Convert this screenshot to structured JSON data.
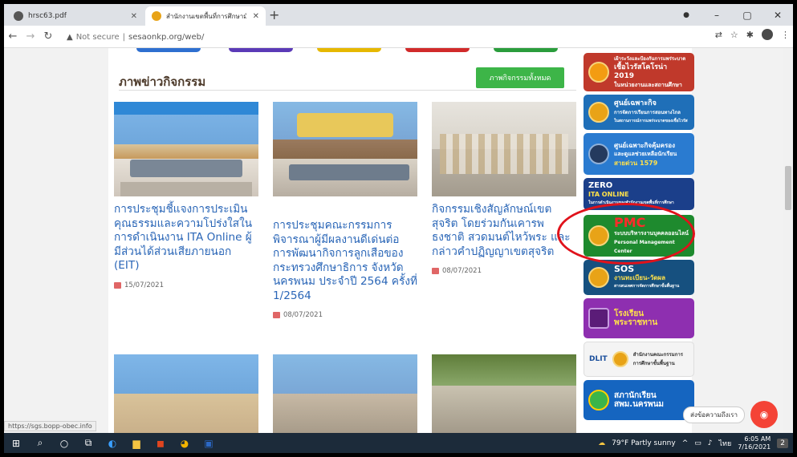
{
  "tabs": [
    {
      "title": "hrsc63.pdf"
    },
    {
      "title": "สำนักงานเขตพื้นที่การศึกษามัธยมศึกษ"
    }
  ],
  "address": {
    "security": "Not secure",
    "separator": "|",
    "url": "sesaonkp.org/web/"
  },
  "section": {
    "title": "ภาพข่าวกิจกรรม",
    "all_button": "ภาพกิจกรรมทั้งหมด"
  },
  "cards": [
    {
      "title": "การประชุมชี้แจงการประเมินคุณธรรมและความโปร่งใสในการดำเนินงาน ITA Online ผู้มีส่วนได้ส่วนเสียภายนอก (EIT)",
      "date": "15/07/2021"
    },
    {
      "title": "การประชุมคณะกรรมการพิจารณาผู้มีผลงานดีเด่นต่อการพัฒนากิจการลูกเสือของกระทรวงศึกษาธิการ จังหวัดนครพนม ประจำปี 2564 ครั้งที่ 1/2564",
      "date": "08/07/2021"
    },
    {
      "title": "กิจกรรมเชิงสัญลักษณ์เขตสุจริต โดยร่วมกันเคารพธงชาติ สวดมนต์ไหว้พระ และกล่าวคำปฏิญญาเขตสุจริต",
      "date": "08/07/2021"
    }
  ],
  "banners": [
    {
      "line1": "เฝ้าระวังและป้องกันการแพร่ระบาด",
      "line2": "เชื้อไวรัสโคโรน่า 2019",
      "line3": "ในหน่วยงานและสถานศึกษา",
      "bg": "#c0392b"
    },
    {
      "line1": "ศูนย์เฉพาะกิจ",
      "line2": "การจัดการเรียนการสอนทางไกล",
      "line3": "ในสถานการณ์การแพร่ระบาดของเชื้อไวรัส",
      "bg": "#1f6fb8"
    },
    {
      "line1": "ศูนย์เฉพาะกิจคุ้มครอง",
      "line2": "และดูแลช่วยเหลือนักเรียน",
      "line3": "สายด่วน 1579",
      "bg": "#2a7bd0"
    },
    {
      "line1": "ZERO",
      "line2": "ITA ONLINE",
      "line3": "ในการดำเนินงานของสำนักงานเขตพื้นที่การศึกษา",
      "bg": "#1b3f8a"
    },
    {
      "line1": "PMC",
      "line2": "ระบบบริหารงานบุคคลออนไลน์",
      "line3": "Personal Management Center",
      "bg": "#1e8a2e"
    },
    {
      "line1": "SOS",
      "line2": "งานทะเบียน-วัดผล",
      "line3": "สารสนเทศการจัดการศึกษาขั้นพื้นฐาน",
      "bg": "#16507f"
    },
    {
      "line1": "โรงเรียน",
      "line2": "พระราชทาน",
      "line3": "",
      "bg": "#8e2fb0"
    },
    {
      "line1": "DLIT",
      "line2": "สำนักงานคณะกรรมการ",
      "line3": "การศึกษาขั้นพื้นฐาน",
      "bg": "#f4f4f4"
    },
    {
      "line1": "สภานักเรียน",
      "line2": "สพม.นครพนม",
      "line3": "",
      "bg": "#1565c0"
    }
  ],
  "status_url": "https://sgs.bopp-obec.info",
  "chat": {
    "label": "ส่งข้อความถึงเรา"
  },
  "taskbar": {
    "weather": "79°F Partly sunny",
    "lang": "ไทย",
    "time": "6:05 AM",
    "date": "7/16/2021",
    "notif": "2"
  }
}
